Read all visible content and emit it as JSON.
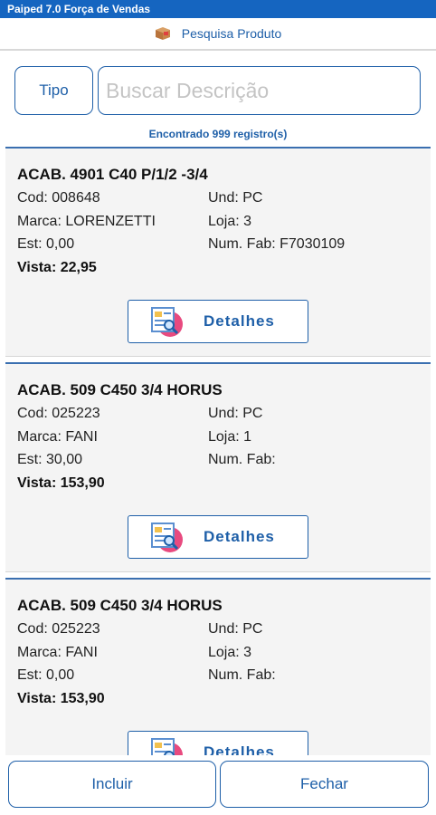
{
  "titlebar": {
    "text": "Paiped 7.0 Força de Vendas"
  },
  "header": {
    "icon": "box-icon",
    "title": "Pesquisa Produto"
  },
  "search": {
    "tipo_label": "Tipo",
    "placeholder": "Buscar Descrição",
    "value": ""
  },
  "count_text": "Encontrado 999 registro(s)",
  "products": [
    {
      "title": "ACAB. 4901 C40 P/1/2 -3/4",
      "cod": "Cod: 008648",
      "und": "Und: PC",
      "marca": "Marca: LORENZETTI",
      "loja": "Loja: 3",
      "est": "Est: 0,00",
      "numfab": "Num. Fab: F7030109",
      "vista": "Vista: 22,95",
      "details_label": "Detalhes"
    },
    {
      "title": "ACAB. 509 C450 3/4 HORUS",
      "cod": "Cod: 025223",
      "und": "Und: PC",
      "marca": "Marca: FANI",
      "loja": "Loja: 1",
      "est": "Est: 30,00",
      "numfab": "Num. Fab:",
      "vista": "Vista: 153,90",
      "details_label": "Detalhes"
    },
    {
      "title": "ACAB. 509 C450 3/4 HORUS",
      "cod": "Cod: 025223",
      "und": "Und: PC",
      "marca": "Marca: FANI",
      "loja": "Loja: 3",
      "est": "Est: 0,00",
      "numfab": "Num. Fab:",
      "vista": "Vista: 153,90",
      "details_label": "Detalhes"
    }
  ],
  "footer": {
    "incluir_label": "Incluir",
    "fechar_label": "Fechar"
  },
  "colors": {
    "titlebar": "#1565c0",
    "accent": "#1e5fa8",
    "card_bg": "#f4f4f4",
    "icon_pink": "#e84a7f"
  }
}
